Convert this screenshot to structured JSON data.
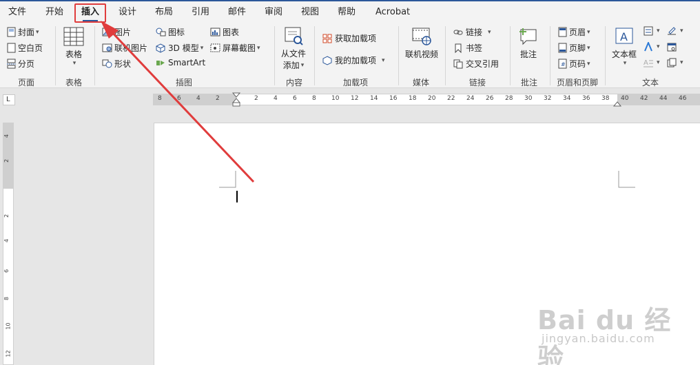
{
  "menu": {
    "tabs": [
      {
        "label": "文件"
      },
      {
        "label": "开始"
      },
      {
        "label": "插入"
      },
      {
        "label": "设计"
      },
      {
        "label": "布局"
      },
      {
        "label": "引用"
      },
      {
        "label": "邮件"
      },
      {
        "label": "审阅"
      },
      {
        "label": "视图"
      },
      {
        "label": "帮助"
      },
      {
        "label": "Acrobat"
      }
    ],
    "active_tab": "插入",
    "highlight_color": "#e03c3c"
  },
  "ribbon": {
    "pages": {
      "group_label": "页面",
      "cover": "封面",
      "blank": "空白页",
      "break": "分页"
    },
    "tables": {
      "group_label": "表格",
      "table": "表格"
    },
    "illustrations": {
      "group_label": "插图",
      "pictures": "图片",
      "online_pictures": "联机图片",
      "shapes": "形状",
      "icons": "图标",
      "models_3d": "3D 模型",
      "smartart": "SmartArt",
      "chart": "图表",
      "screenshot": "屏幕截图"
    },
    "content": {
      "group_label": "内容",
      "from_file_line1": "从文件",
      "from_file_line2": "添加"
    },
    "addins": {
      "group_label": "加载项",
      "get": "获取加载项",
      "mine": "我的加载项"
    },
    "media": {
      "group_label": "媒体",
      "online_video": "联机视频"
    },
    "links": {
      "group_label": "链接",
      "link": "链接",
      "bookmark": "书签",
      "cross_ref": "交叉引用"
    },
    "comments": {
      "group_label": "批注",
      "comment": "批注"
    },
    "header_footer": {
      "group_label": "页眉和页脚",
      "header": "页眉",
      "footer": "页脚",
      "page_number": "页码"
    },
    "text": {
      "group_label": "文本",
      "textbox": "文本框"
    }
  },
  "ruler": {
    "horizontal_ticks": [
      "8",
      "6",
      "4",
      "2",
      "2",
      "4",
      "6",
      "8",
      "10",
      "12",
      "14",
      "16",
      "18",
      "20",
      "22",
      "24",
      "26",
      "28",
      "30",
      "32",
      "34",
      "36",
      "38",
      "40",
      "42",
      "44",
      "46"
    ],
    "vertical_ticks": [
      "4",
      "2",
      "2",
      "4",
      "6",
      "8",
      "10",
      "12"
    ],
    "corner_symbol": "L"
  },
  "watermark": {
    "brand": "Bai du 经验",
    "url": "jingyan.baidu.com"
  },
  "colors": {
    "accent": "#2b579a",
    "ribbon_bg": "#f3f3f3",
    "canvas_bg": "#e6e6e6",
    "annotation_red": "#e03c3c"
  }
}
